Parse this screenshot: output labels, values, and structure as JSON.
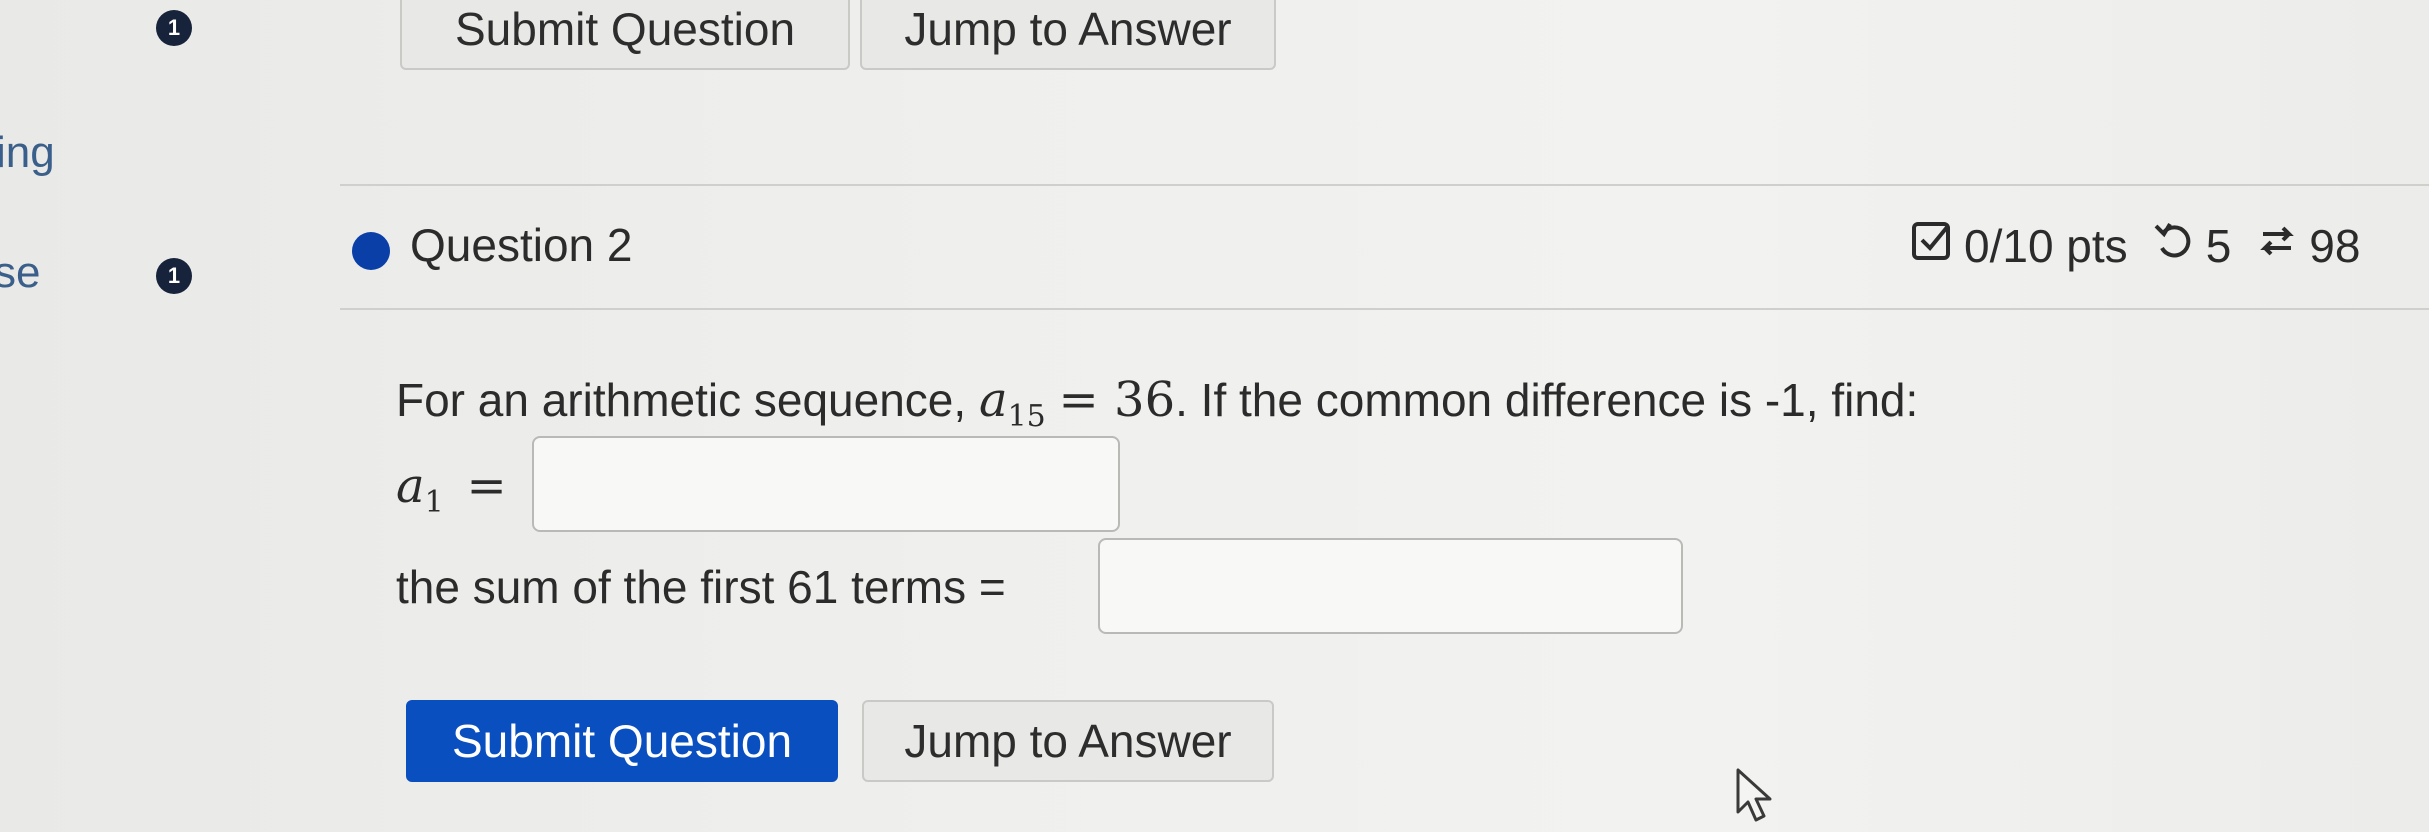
{
  "top_bar": {
    "badge": "1",
    "submit_label": "Submit Question",
    "jump_label": "Jump to Answer"
  },
  "sidebar": {
    "items": [
      {
        "label": "ing"
      },
      {
        "label": "se",
        "badge": "1"
      }
    ]
  },
  "question": {
    "title": "Question 2",
    "points": "0/10 pts",
    "retries": "5",
    "attempts": "98"
  },
  "problem": {
    "intro": "For an arithmetic sequence,",
    "var": "a",
    "sub15": "15",
    "equals_value": "= 36",
    "rest": ". If the common difference is -1, find:",
    "a1_var": "a",
    "a1_sub": "1",
    "a1_equals": "=",
    "sum_label": "the sum of the first 61 terms ="
  },
  "answers": {
    "a1_value": "",
    "sum_value": ""
  },
  "actions": {
    "submit_label": "Submit Question",
    "jump_label": "Jump to Answer"
  },
  "colors": {
    "accent": "#0a4fc0",
    "badge": "#17233b",
    "question_dot": "#0a3fa8"
  }
}
